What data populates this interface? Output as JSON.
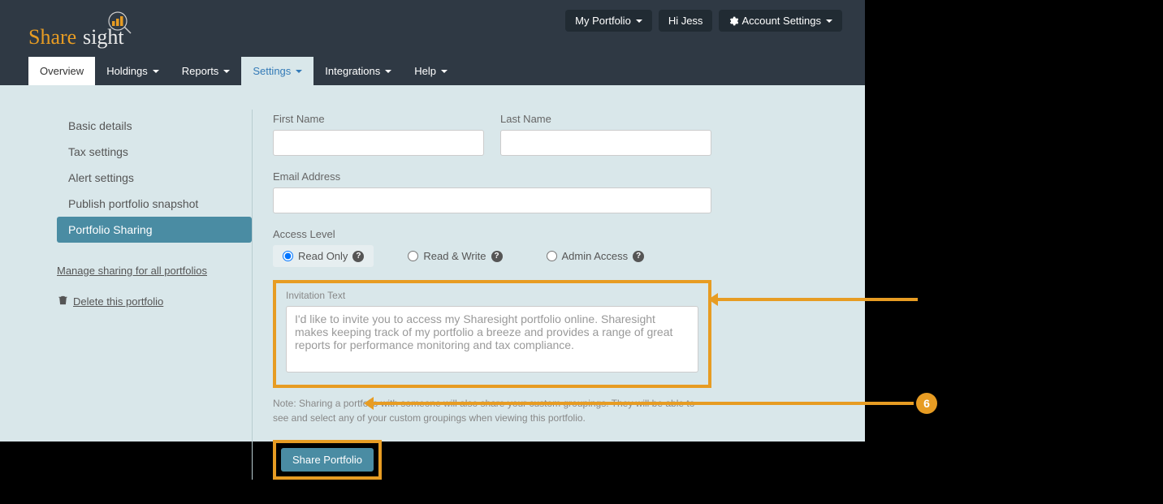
{
  "logo_text_1": "Share",
  "logo_text_2": "sight",
  "topnav": {
    "portfolio": "My Portfolio",
    "greeting": "Hi Jess",
    "account": "Account Settings"
  },
  "tabs": {
    "overview": "Overview",
    "holdings": "Holdings",
    "reports": "Reports",
    "settings": "Settings",
    "integrations": "Integrations",
    "help": "Help"
  },
  "sidebar": {
    "items": [
      "Basic details",
      "Tax settings",
      "Alert settings",
      "Publish portfolio snapshot",
      "Portfolio Sharing"
    ],
    "manage_link": "Manage sharing for all portfolios",
    "delete_link": "Delete this portfolio"
  },
  "form": {
    "first_name_label": "First Name",
    "last_name_label": "Last Name",
    "email_label": "Email Address",
    "access_label": "Access Level",
    "access_options": {
      "read": "Read Only",
      "rw": "Read & Write",
      "admin": "Admin Access"
    },
    "invitation_label": "Invitation Text",
    "invitation_text": "I'd like to invite you to access my Sharesight portfolio online. Sharesight makes keeping track of my portfolio a breeze and provides a range of great reports for performance monitoring and tax compliance.",
    "note": "Note: Sharing a portfolio with someone will also share your custom groupings. They will be able to see and select any of your custom groupings when viewing this portfolio.",
    "share_btn": "Share Portfolio"
  },
  "annotation": {
    "step": "6"
  }
}
